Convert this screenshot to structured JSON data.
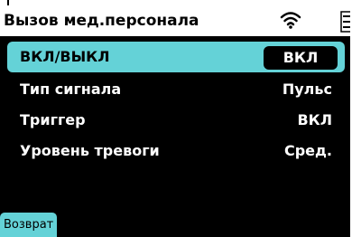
{
  "titlebar": {
    "title": "Вызов мед.персонала",
    "wifi_icon": "wifi-icon",
    "menu_icon": "menu-icon"
  },
  "rows": [
    {
      "label": "ВКЛ/ВЫКЛ",
      "value": "ВКЛ",
      "selected": true
    },
    {
      "label": "Тип сигнала",
      "value": "Пульс",
      "selected": false
    },
    {
      "label": "Триггер",
      "value": "ВКЛ",
      "selected": false
    },
    {
      "label": "Уровень тревоги",
      "value": "Сред.",
      "selected": false
    }
  ],
  "footer": {
    "back_label": "Возврат"
  },
  "colors": {
    "accent": "#64d2d7",
    "background": "#000000",
    "titlebar": "#ffffff"
  }
}
